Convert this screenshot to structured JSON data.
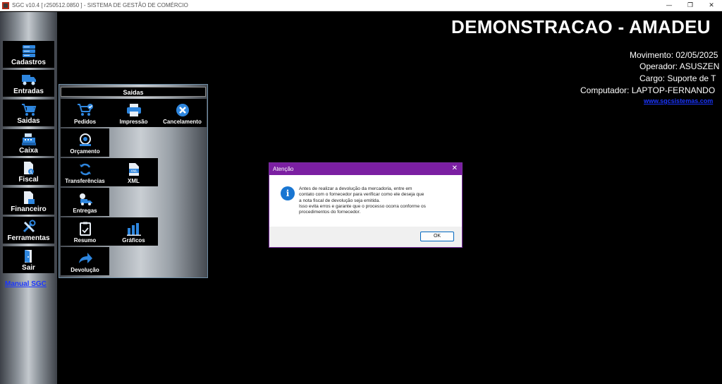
{
  "window": {
    "title": "SGC v10.4 [ r250512.0850 ] - SISTEMA DE GESTÃO DE COMÉRCIO",
    "minimize": "—",
    "restore": "❐",
    "close": "✕"
  },
  "sidebar": {
    "items": [
      {
        "label": "Cadastros",
        "icon": "database-icon"
      },
      {
        "label": "Entradas",
        "icon": "truck-icon"
      },
      {
        "label": "Saidas",
        "icon": "cart-icon"
      },
      {
        "label": "Caixa",
        "icon": "cash-register-icon"
      },
      {
        "label": "Fiscal",
        "icon": "fiscal-document-icon"
      },
      {
        "label": "Financeiro",
        "icon": "finance-document-icon"
      },
      {
        "label": "Ferramentas",
        "icon": "tools-icon"
      },
      {
        "label": "Sair",
        "icon": "exit-door-icon"
      }
    ],
    "manual_link": "Manual SGC"
  },
  "saidas_panel": {
    "header": "Saidas",
    "tiles": {
      "pedidos": {
        "label": "Pedidos",
        "icon": "cart-check-icon"
      },
      "impressao": {
        "label": "Impressão",
        "icon": "printer-icon"
      },
      "cancelamento": {
        "label": "Cancelamento",
        "icon": "cancel-circle-icon"
      },
      "orcamento": {
        "label": "Orçamento",
        "icon": "quote-icon"
      },
      "transferencias": {
        "label": "Transferências",
        "icon": "sync-icon"
      },
      "xml": {
        "label": "XML",
        "icon": "xml-file-icon"
      },
      "entregas": {
        "label": "Entregas",
        "icon": "delivery-icon"
      },
      "resumo": {
        "label": "Resumo",
        "icon": "clipboard-icon"
      },
      "graficos": {
        "label": "Gráficos",
        "icon": "bar-chart-icon"
      },
      "devolucao": {
        "label": "Devolução",
        "icon": "return-arrow-icon"
      }
    }
  },
  "company": {
    "name": "DEMONSTRACAO - AMADEU",
    "movimento": "Movimento: 02/05/2025",
    "operador": "Operador: ASUSZEN",
    "cargo": "Cargo: Suporte de T",
    "computador": "Computador: LAPTOP-FERNANDO",
    "website": "www.sgcsistemas.com"
  },
  "dialog": {
    "title": "Atenção",
    "close": "✕",
    "icon": "info-icon",
    "message_lines": [
      "Antes de realizar a devolução da mercadoria, entre em",
      "contato com o fornecedor para verificar como ele deseja que",
      "a nota fiscal de devolução seja emitida.",
      "Isso evita erros e garante que o processo ocorra conforme os",
      "procedimentos do fornecedor."
    ],
    "ok_label": "OK"
  },
  "colors": {
    "background": "#000000",
    "dialog_titlebar": "#7b1fa2",
    "link": "#1a35ff",
    "icon_blue": "#2e86de"
  }
}
